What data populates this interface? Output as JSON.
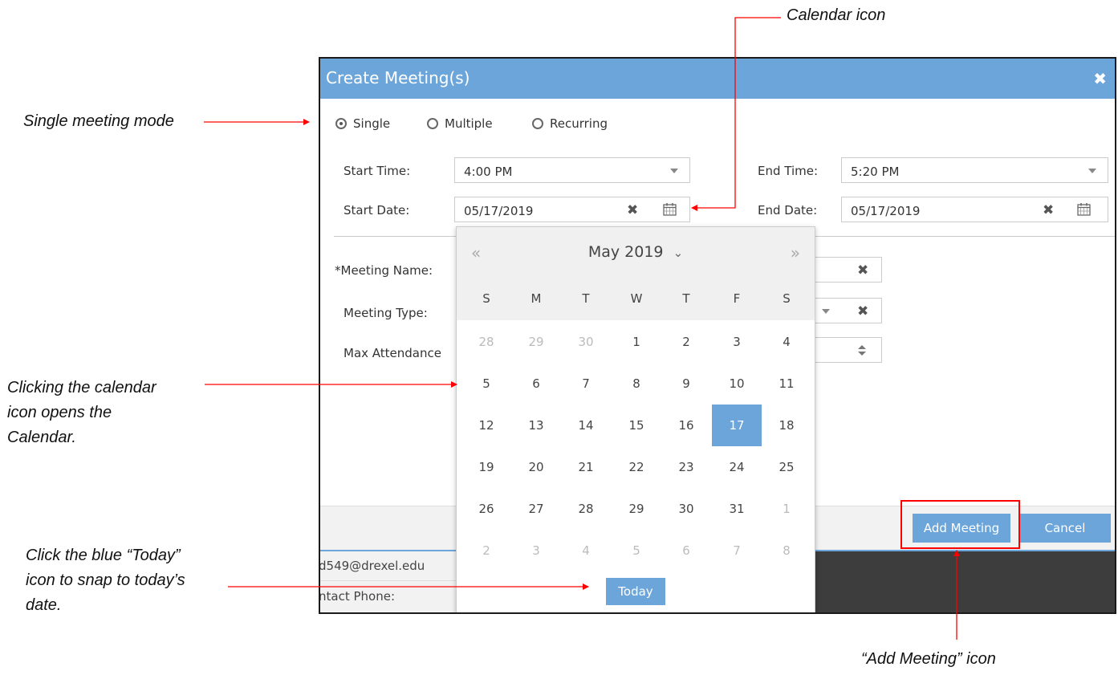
{
  "annotations": {
    "calendar_icon": "Calendar icon",
    "single_mode": "Single meeting mode",
    "calendar_open": [
      "Clicking the calendar",
      "icon opens the",
      "Calendar."
    ],
    "today_hint": [
      "Click the blue “Today”",
      "icon to snap to today’s",
      "date."
    ],
    "add_meeting_icon": "“Add Meeting” icon"
  },
  "dialog": {
    "title": "Create Meeting(s)",
    "close_icon": "close-icon",
    "modes": [
      "Single",
      "Multiple",
      "Recurring"
    ],
    "selected_mode": "Single",
    "start_time_label": "Start Time:",
    "start_time": "4:00 PM",
    "end_time_label": "End Time:",
    "end_time": "5:20 PM",
    "start_date_label": "Start Date:",
    "start_date": "05/17/2019",
    "end_date_label": "End Date:",
    "end_date": "05/17/2019",
    "meeting_name_label": "*Meeting Name:",
    "meeting_type_label": "Meeting Type:",
    "max_attendance_label": "Max Attendance",
    "add_button": "Add Meeting",
    "cancel_button": "Cancel"
  },
  "background": {
    "email": "d549@drexel.edu",
    "phone_label": "ntact Phone:"
  },
  "calendar": {
    "prev": "«",
    "next": "»",
    "month_label": "May 2019",
    "dropdown": "⌄",
    "weekdays": [
      "S",
      "M",
      "T",
      "W",
      "T",
      "F",
      "S"
    ],
    "weeks": [
      [
        "28",
        "29",
        "30",
        "1",
        "2",
        "3",
        "4"
      ],
      [
        "5",
        "6",
        "7",
        "8",
        "9",
        "10",
        "11"
      ],
      [
        "12",
        "13",
        "14",
        "15",
        "16",
        "17",
        "18"
      ],
      [
        "19",
        "20",
        "21",
        "22",
        "23",
        "24",
        "25"
      ],
      [
        "26",
        "27",
        "28",
        "29",
        "30",
        "31",
        "1"
      ],
      [
        "2",
        "3",
        "4",
        "5",
        "6",
        "7",
        "8"
      ]
    ],
    "selected_day": "17",
    "today_button": "Today"
  },
  "colors": {
    "accent": "#6ba5da",
    "arrow": "#ff0000",
    "highlight_box": "#ff0000"
  }
}
